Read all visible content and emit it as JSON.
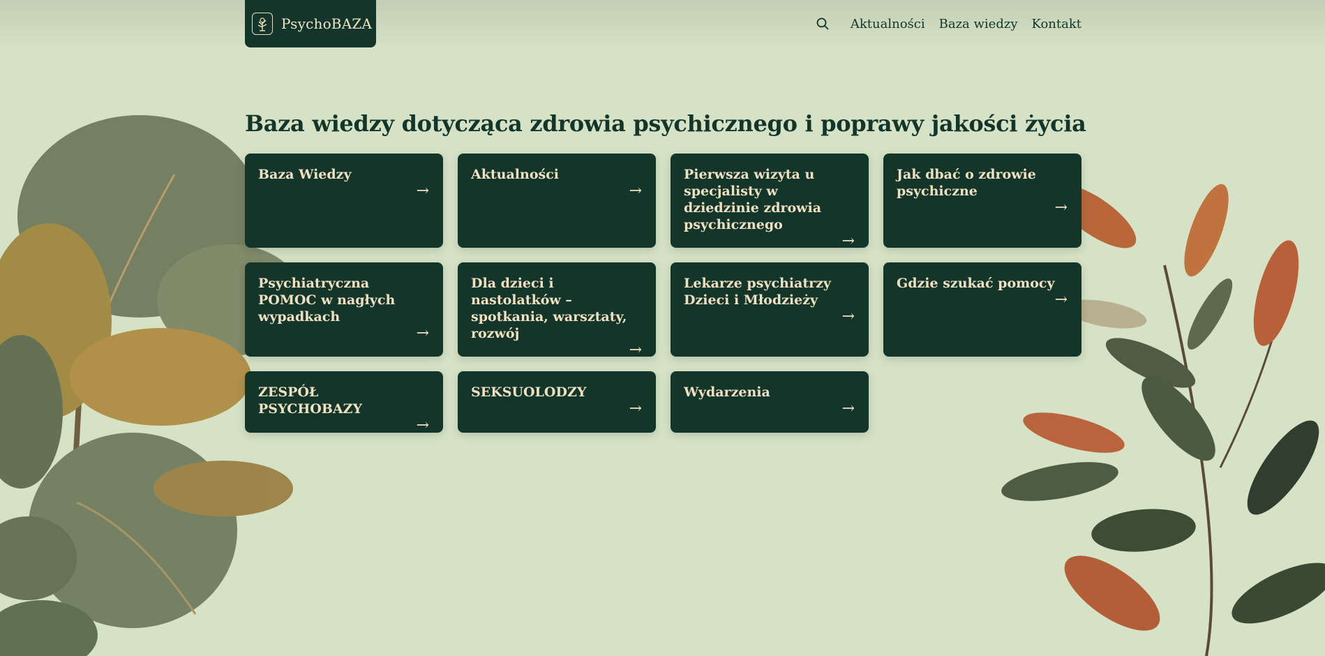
{
  "header": {
    "logo_text": "PsychoBAZA",
    "nav": [
      {
        "label": "Aktualności"
      },
      {
        "label": "Baza wiedzy"
      },
      {
        "label": "Kontakt"
      }
    ]
  },
  "main": {
    "title": "Baza wiedzy dotycząca zdrowia psychicznego i poprawy jakości życia",
    "cards": [
      {
        "label": "Baza Wiedzy",
        "arrow": "→"
      },
      {
        "label": "Aktualności",
        "arrow": "→"
      },
      {
        "label": "Pierwsza wizyta u specjalisty w dziedzinie zdrowia psychicznego",
        "arrow": "→"
      },
      {
        "label": "Jak dbać o zdrowie psychiczne",
        "arrow": "→"
      },
      {
        "label": "Psychiatryczna POMOC w nagłych wypadkach",
        "arrow": "→"
      },
      {
        "label": "Dla dzieci i nastolatków – spotkania, warsztaty, rozwój",
        "arrow": "→"
      },
      {
        "label": "Lekarze psychiatrzy Dzieci i Młodzieży",
        "arrow": "→"
      },
      {
        "label": "Gdzie szukać pomocy",
        "arrow": "→"
      },
      {
        "label": "ZESPÓŁ PSYCHOBAZY",
        "arrow": "→"
      },
      {
        "label": "SEKSUOLODZY",
        "arrow": "→"
      },
      {
        "label": "Wydarzenia",
        "arrow": "→"
      }
    ]
  },
  "colors": {
    "background": "#d6e2c6",
    "card": "#14352a",
    "card_text": "#eee0c0"
  }
}
